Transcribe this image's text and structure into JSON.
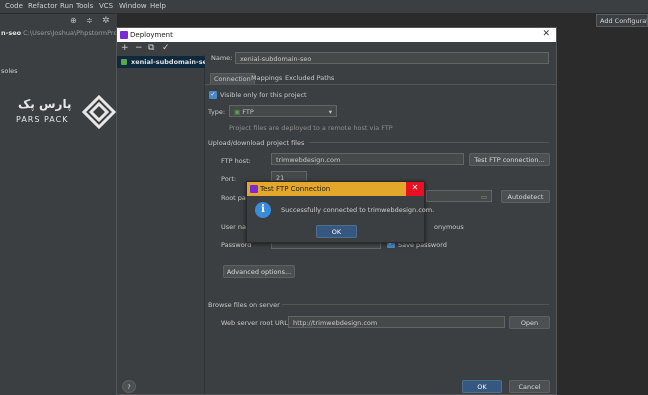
{
  "menubar": {
    "items": [
      "Code",
      "Refactor",
      "Run",
      "Tools",
      "VCS",
      "Window",
      "Help"
    ],
    "add_config": "Add Configuration..."
  },
  "ide_left": {
    "project_prefix": "n-seo",
    "project_path": "C:\\Users\\Joshua\\PhpstormProjects",
    "consoles": "soles"
  },
  "logo": {
    "fa_text": "پارس پک",
    "en_text": "PARS PACK"
  },
  "deployment": {
    "title": "Deployment",
    "server": "xenial-subdomain-seo",
    "name_label": "Name:",
    "name_value": "xenial-subdomain-seo",
    "tabs": [
      "Connection",
      "Mappings",
      "Excluded Paths"
    ],
    "visible_only": "Visible only for this project",
    "type_label": "Type:",
    "type_value": "FTP",
    "type_note": "Project files are deployed to a remote host via FTP",
    "upload_section": "Upload/download project files",
    "ftp_host_label": "FTP host:",
    "ftp_host_value": "trimwebdesign.com",
    "test_btn": "Test FTP connection...",
    "port_label": "Port:",
    "port_value": "21",
    "root_path_label": "Root pat",
    "autodetect_btn": "Autodetect",
    "user_label": "User nam",
    "anonymous_label": "onymous",
    "password_label": "Password",
    "save_password_label": "Save password",
    "advanced_btn": "Advanced options...",
    "browse_section": "Browse files on server",
    "web_root_label": "Web server root URL:",
    "web_root_value": "http://trimwebdesign.com",
    "open_btn": "Open",
    "ok_btn": "OK",
    "cancel_btn": "Cancel",
    "help_btn": "?"
  },
  "ftp_dialog": {
    "title": "Test FTP Connection",
    "message": "Successfully connected to trimwebdesign.com.",
    "ok_btn": "OK"
  },
  "colors": {
    "accent": "#365880",
    "selection": "#0d293e",
    "warning_title": "#e3a72c",
    "close_red": "#e81123",
    "info_blue": "#3a8bd9"
  }
}
